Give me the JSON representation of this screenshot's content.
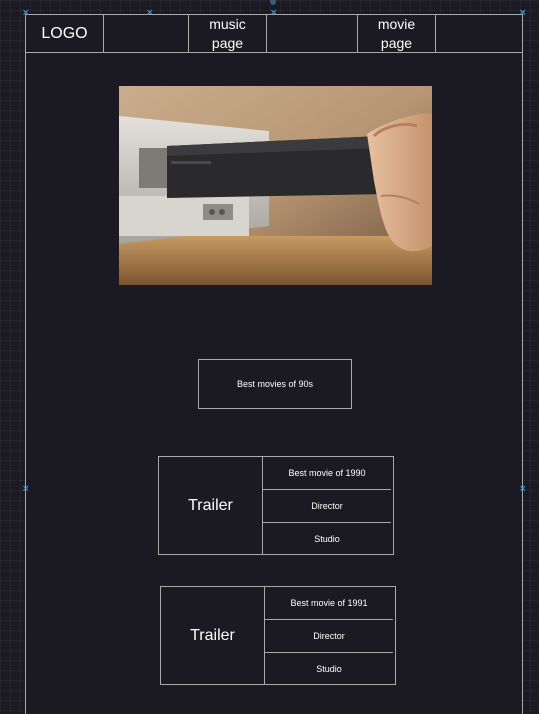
{
  "nav": {
    "logo": "LOGO",
    "music_page": "music\npage",
    "movie_page": "movie\npage"
  },
  "hero": {
    "alt": "Hand inserting a VHS tape into a VCR"
  },
  "best_button": "Best movies of 90s",
  "cards": [
    {
      "trailer": "Trailer",
      "title": "Best movie of 1990",
      "director": "Director",
      "studio": "Studio"
    },
    {
      "trailer": "Trailer",
      "title": "Best movie of 1991",
      "director": "Director",
      "studio": "Studio"
    }
  ]
}
